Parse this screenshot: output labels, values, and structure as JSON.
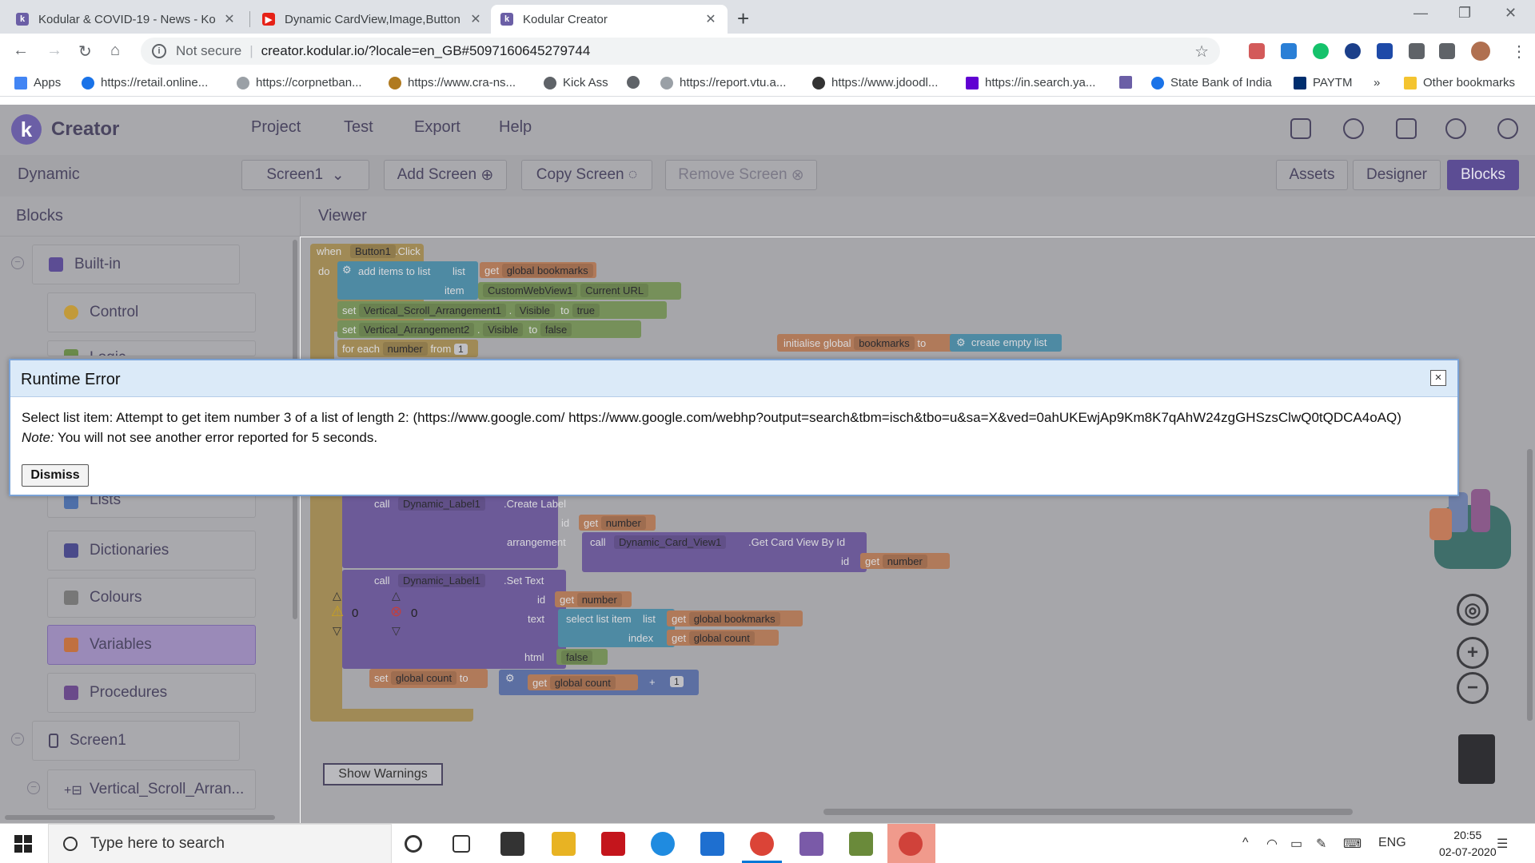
{
  "browser": {
    "tabs": [
      {
        "title": "Kodular & COVID-19 - News - Ko",
        "favicon": "kodular-icon"
      },
      {
        "title": "Dynamic CardView,Image,Button",
        "favicon": "youtube-icon"
      },
      {
        "title": "Kodular Creator",
        "favicon": "kodular-icon"
      }
    ],
    "omnibox": {
      "security": "Not secure",
      "url": "creator.kodular.io/?locale=en_GB#5097160645279744"
    },
    "bookmarks": [
      "Apps",
      "https://retail.online...",
      "https://corpnetban...",
      "https://www.cra-ns...",
      "Kick Ass",
      "",
      "https://report.vtu.a...",
      "https://www.jdoodl...",
      "https://in.search.ya...",
      "",
      "State Bank of India",
      "PAYTM",
      "»",
      "Other bookmarks"
    ]
  },
  "kodular": {
    "title": "Creator",
    "menu": [
      "Project",
      "Test",
      "Export",
      "Help"
    ],
    "project_name": "Dynamic",
    "screen_select": "Screen1",
    "add_screen": "Add Screen",
    "copy_screen": "Copy Screen",
    "remove_screen": "Remove Screen",
    "assets": "Assets",
    "designer": "Designer",
    "blocks": "Blocks",
    "blocks_header": "Blocks",
    "viewer_header": "Viewer",
    "tree": {
      "builtin": "Built-in",
      "control": "Control",
      "logic": "Logic",
      "lists": "Lists",
      "dictionaries": "Dictionaries",
      "colours": "Colours",
      "variables": "Variables",
      "procedures": "Procedures",
      "screen1": "Screen1",
      "vsa": "Vertical_Scroll_Arran..."
    },
    "warnings": {
      "warn_count": "0",
      "error_count": "0",
      "show_label": "Show Warnings"
    }
  },
  "workspace": {
    "when": "when",
    "button1": "Button1",
    "click": ".Click",
    "do": "do",
    "add_items": "add items to list",
    "list": "list",
    "get": "get",
    "global_bookmarks": "global bookmarks",
    "item": "item",
    "custom_web_view": "CustomWebView1",
    "current_url": "Current URL",
    "set": "set",
    "vsa": "Vertical_Scroll_Arrangement1",
    "visible": "Visible",
    "to": "to",
    "true_val": "true",
    "va2": "Vertical_Arrangement2",
    "false_val": "false",
    "for_each": "for each",
    "number": "number",
    "from": "from",
    "one": "1",
    "init_global": "initialise global",
    "bookmarks": "bookmarks",
    "create_empty": "create empty list",
    "call": "call",
    "dyn_label": "Dynamic_Label1",
    "create_label": ".Create Label",
    "id": "id",
    "arrangement": "arrangement",
    "dyn_card": "Dynamic_Card_View1",
    "get_card": ".Get Card View By Id",
    "set_text": ".Set Text",
    "text": "text",
    "select_list_item": "select list item",
    "index": "index",
    "global_count": "global count",
    "html": "html",
    "plus": "+"
  },
  "dialog": {
    "title": "Runtime Error",
    "close": "×",
    "message": "Select list item: Attempt to get item number 3 of a list of length 2: (https://www.google.com/ https://www.google.com/webhp?output=search&tbm=isch&tbo=u&sa=X&ved=0ahUKEwjAp9Km8K7qAhW24zgGHSzsClwQ0tQDCA4oAQ)",
    "note_label": "Note:",
    "note_text": " You will not see another error reported for 5 seconds.",
    "dismiss": "Dismiss"
  },
  "taskbar": {
    "search_placeholder": "Type here to search",
    "lang": "ENG",
    "time": "20:55",
    "date": "02-07-2020"
  }
}
